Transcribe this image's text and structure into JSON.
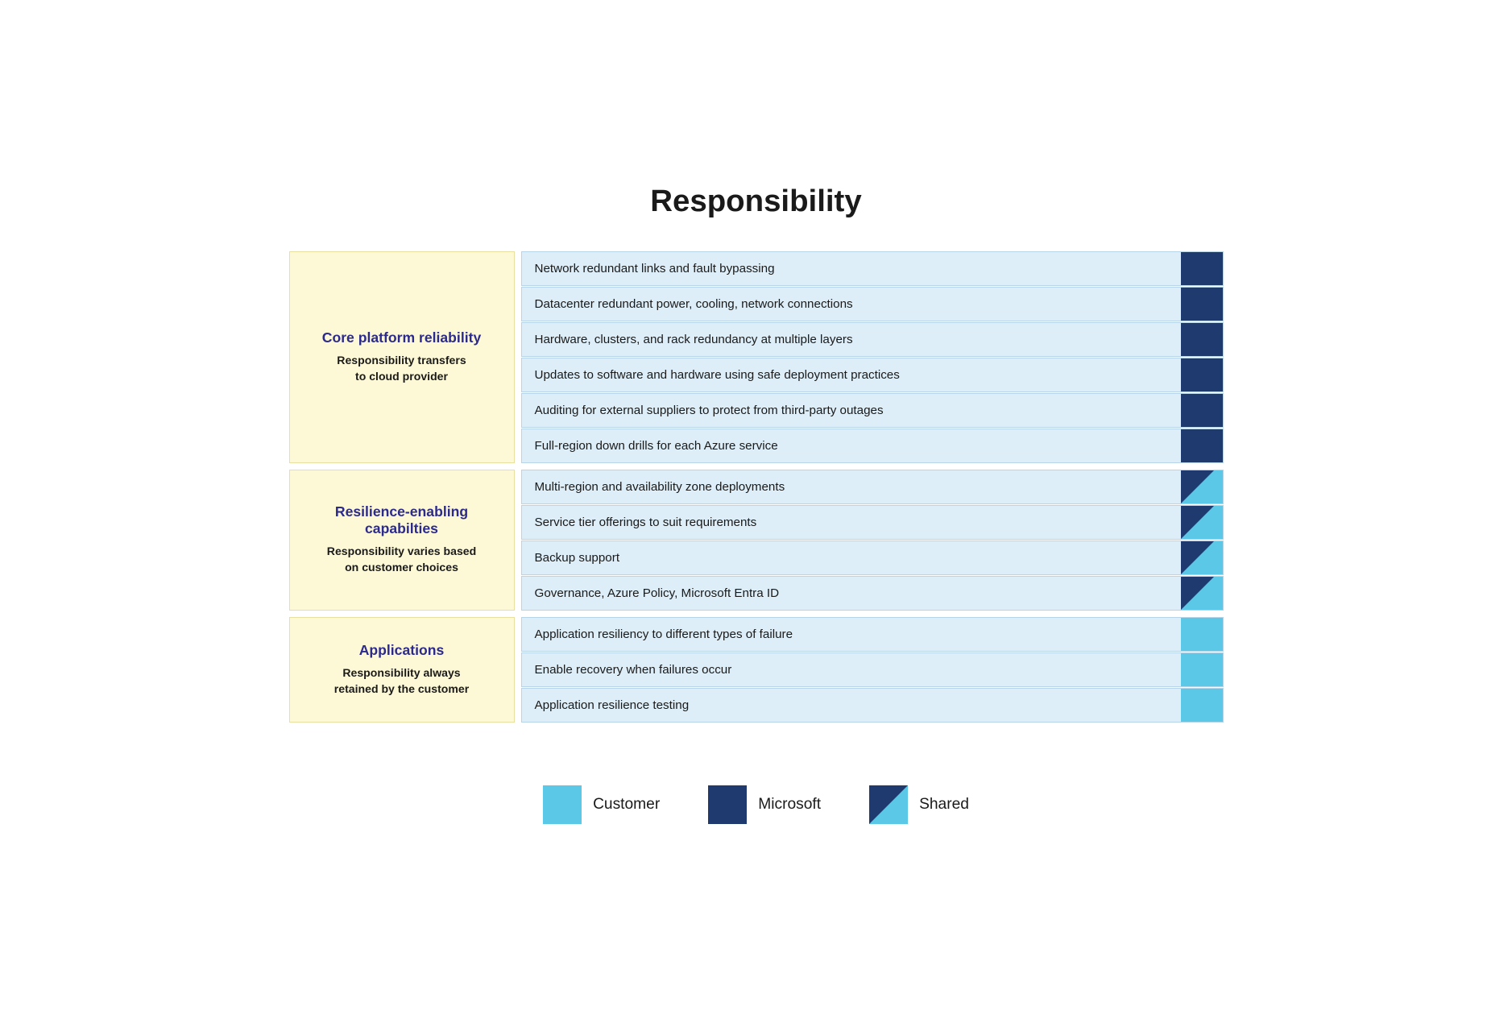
{
  "page": {
    "title": "Responsibility"
  },
  "sections": [
    {
      "id": "core-platform",
      "title": "Core platform reliability",
      "subtitle": "Responsibility transfers\nto cloud provider",
      "items": [
        {
          "text": "Network redundant links and fault bypassing",
          "type": "microsoft"
        },
        {
          "text": "Datacenter redundant power, cooling, network connections",
          "type": "microsoft"
        },
        {
          "text": "Hardware, clusters, and rack redundancy at multiple layers",
          "type": "microsoft"
        },
        {
          "text": "Updates to software and hardware using safe deployment practices",
          "type": "microsoft"
        },
        {
          "text": "Auditing for external suppliers to protect from third-party outages",
          "type": "microsoft"
        },
        {
          "text": "Full-region down drills for each Azure service",
          "type": "microsoft"
        }
      ]
    },
    {
      "id": "resilience-enabling",
      "title": "Resilience-enabling capabilties",
      "subtitle": "Responsibility varies based\non customer choices",
      "items": [
        {
          "text": "Multi-region and availability zone deployments",
          "type": "shared"
        },
        {
          "text": "Service tier offerings to suit requirements",
          "type": "shared"
        },
        {
          "text": "Backup support",
          "type": "shared"
        },
        {
          "text": "Governance, Azure Policy, Microsoft Entra ID",
          "type": "shared"
        }
      ]
    },
    {
      "id": "applications",
      "title": "Applications",
      "subtitle": "Responsibility always\nretained by the customer",
      "items": [
        {
          "text": "Application resiliency to different types of failure",
          "type": "customer"
        },
        {
          "text": "Enable recovery when failures occur",
          "type": "customer"
        },
        {
          "text": "Application resilience testing",
          "type": "customer"
        }
      ]
    }
  ],
  "legend": {
    "items": [
      {
        "id": "customer",
        "label": "Customer",
        "type": "customer"
      },
      {
        "id": "microsoft",
        "label": "Microsoft",
        "type": "microsoft"
      },
      {
        "id": "shared",
        "label": "Shared",
        "type": "shared"
      }
    ]
  }
}
